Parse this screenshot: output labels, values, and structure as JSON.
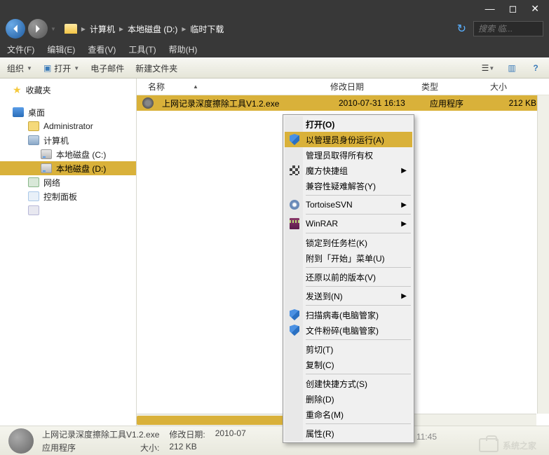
{
  "titlebar": {
    "min": "—",
    "max": "◻",
    "close": "✕"
  },
  "breadcrumb": {
    "items": [
      "计算机",
      "本地磁盘 (D:)",
      "临时下载"
    ]
  },
  "search": {
    "placeholder": "搜索 临..."
  },
  "menubar": {
    "file": "文件(F)",
    "edit": "编辑(E)",
    "view": "查看(V)",
    "tools": "工具(T)",
    "help": "帮助(H)"
  },
  "toolbar": {
    "organize": "组织",
    "open": "打开",
    "email": "电子邮件",
    "newfolder": "新建文件夹"
  },
  "sidebar": {
    "favorites": "收藏夹",
    "desktop": "桌面",
    "admin": "Administrator",
    "computer": "计算机",
    "driveC": "本地磁盘 (C:)",
    "driveD": "本地磁盘 (D:)",
    "network": "网络",
    "control": "控制面板",
    "recycle": ""
  },
  "columns": {
    "name": "名称",
    "date": "修改日期",
    "type": "类型",
    "size": "大小"
  },
  "file": {
    "name": "上网记录深度擦除工具V1.2.exe",
    "date": "2010-07-31 16:13",
    "type": "应用程序",
    "size": "212 KB"
  },
  "contextmenu": {
    "open": "打开(O)",
    "runas": "以管理员身份运行(A)",
    "takeown": "管理员取得所有权",
    "mofang": "魔方快捷组",
    "compat": "兼容性疑难解答(Y)",
    "svn": "TortoiseSVN",
    "winrar": "WinRAR",
    "pin": "锁定到任务栏(K)",
    "startmenu": "附到「开始」菜单(U)",
    "restore": "还原以前的版本(V)",
    "sendto": "发送到(N)",
    "scan": "扫描病毒(电脑管家)",
    "shred": "文件粉碎(电脑管家)",
    "cut": "剪切(T)",
    "copy": "复制(C)",
    "shortcut": "创建快捷方式(S)",
    "delete": "删除(D)",
    "rename": "重命名(M)",
    "props": "属性(R)"
  },
  "status": {
    "name": "上网记录深度擦除工具V1.2.exe",
    "date_label": "修改日期:",
    "date": "2010-07",
    "date_right": "09 11:45",
    "type": "应用程序",
    "size_label": "大小:",
    "size": "212 KB"
  },
  "watermark": "系统之家"
}
